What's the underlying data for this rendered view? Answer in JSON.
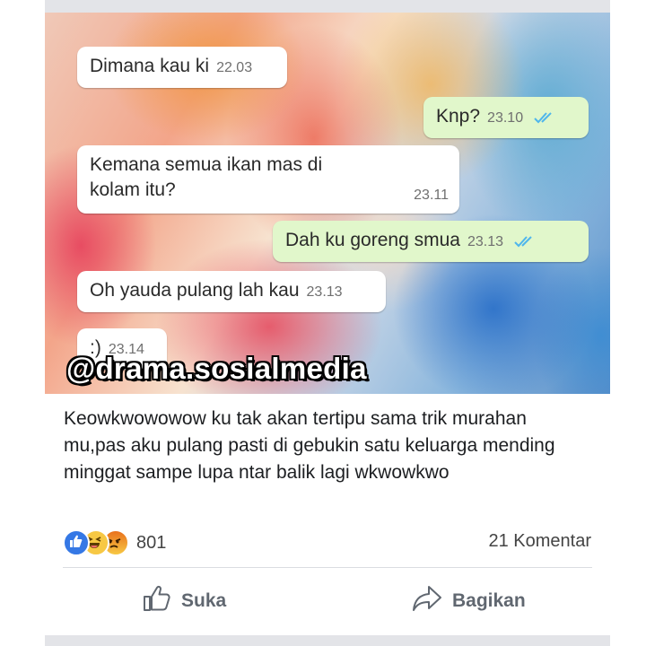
{
  "chat": {
    "messages": [
      {
        "text": "Dimana kau ki",
        "time": "22.03",
        "direction": "incoming"
      },
      {
        "text": "Knp?",
        "time": "23.10",
        "direction": "outgoing"
      },
      {
        "text": "Kemana semua ikan mas di kolam  itu?",
        "time": "23.11",
        "direction": "incoming"
      },
      {
        "text": "Dah ku goreng smua",
        "time": "23.13",
        "direction": "outgoing"
      },
      {
        "text": "Oh yauda pulang lah kau",
        "time": "23.13",
        "direction": "incoming"
      },
      {
        "text": ":)",
        "time": "23.14",
        "direction": "incoming"
      }
    ],
    "incoming_color": "#ffffff",
    "outgoing_color": "#e1f7cb",
    "tick_color": "#4fb6ec"
  },
  "watermark": "@drama.sosialmedia",
  "post": {
    "caption": "Keowkwowowow ku tak akan tertipu sama trik murahan mu,pas aku pulang pasti di gebukin satu keluarga mending minggat sampe lupa ntar balik lagi wkwowkwo",
    "reactions": {
      "icons": [
        "like",
        "haha",
        "angry"
      ],
      "count": "801"
    },
    "comments_label": "21 Komentar",
    "actions": {
      "like_label": "Suka",
      "share_label": "Bagikan"
    }
  }
}
